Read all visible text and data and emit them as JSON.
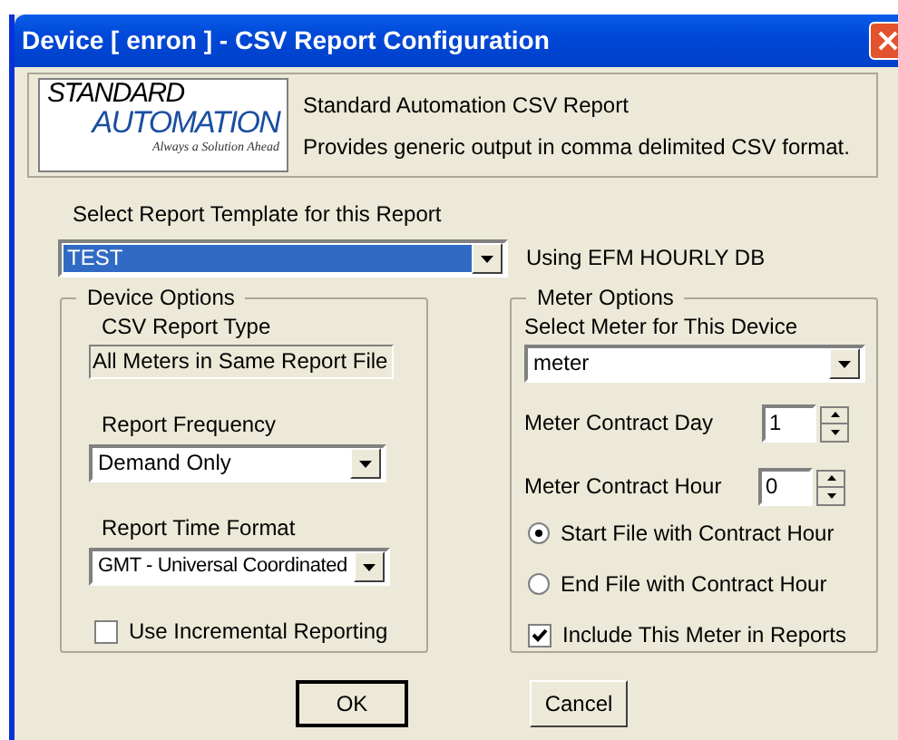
{
  "window": {
    "title": "Device [ enron ] - CSV Report Configuration"
  },
  "header": {
    "logo": {
      "line_1": "STANDARD",
      "line_2": "AUTOMATION",
      "tagline": "Always a Solution Ahead"
    },
    "title": "Standard Automation CSV Report",
    "description": "Provides generic output in comma delimited CSV format."
  },
  "template": {
    "label": "Select Report Template for this Report",
    "value": "TEST",
    "selected": true,
    "note": "Using EFM HOURLY DB"
  },
  "device_options": {
    "title": "Device Options",
    "report_type_label": "CSV Report Type",
    "report_type_value": "All Meters in Same Report File",
    "frequency_label": "Report Frequency",
    "frequency_value": "Demand Only",
    "time_format_label": "Report Time Format",
    "time_format_value": "GMT - Universal Coordinated",
    "incremental": {
      "label": "Use Incremental Reporting",
      "checked": false
    }
  },
  "meter_options": {
    "title": "Meter Options",
    "meter_label": "Select Meter for This Device",
    "meter_value": "meter",
    "contract_day_label": "Meter Contract Day",
    "contract_day_value": "1",
    "contract_hour_label": "Meter Contract Hour",
    "contract_hour_value": "0",
    "radios": [
      {
        "label": "Start File with Contract Hour",
        "selected": true
      },
      {
        "label": "End File with Contract Hour",
        "selected": false
      }
    ],
    "include": {
      "label": "Include This Meter in Reports",
      "checked": true
    }
  },
  "buttons": [
    {
      "label": "OK",
      "default": true
    },
    {
      "label": "Cancel",
      "default": false
    }
  ]
}
